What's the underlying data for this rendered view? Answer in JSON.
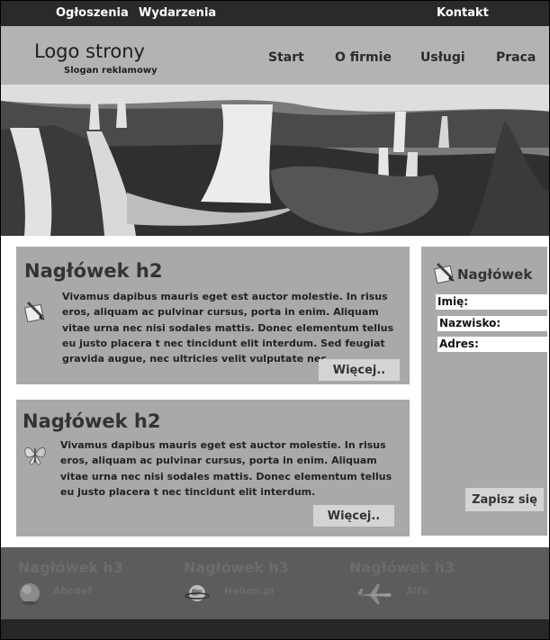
{
  "topnav": {
    "items": [
      "Ogłoszenia",
      "Wydarzenia"
    ],
    "contact": "Kontakt"
  },
  "header": {
    "logo": "Logo strony",
    "slogan": "Slogan reklamowy",
    "nav": [
      "Start",
      "O firmie",
      "Usługi",
      "Praca"
    ]
  },
  "articles": [
    {
      "heading": "Nagłówek h2",
      "text": "Vivamus dapibus mauris eget est auctor molestie. In risus eros, aliquam ac pulvinar cursus, porta in enim. Aliquam vitae urna nec nisi sodales mattis. Donec elementum tellus eu justo placera t nec tincidunt elit interdum. Sed feugiat gravida augue, nec ultricies velit vulputate nec",
      "more": "Więcej..",
      "icon": "pencil-notepad-icon"
    },
    {
      "heading": "Nagłówek h2",
      "text": "Vivamus dapibus mauris eget est auctor molestie. In risus eros, aliquam ac pulvinar cursus, porta in enim. Aliquam vitae urna nec nisi sodales mattis. Donec elementum tellus eu justo placera t nec tincidunt elit interdum.",
      "more": "Więcej..",
      "icon": "butterfly-icon"
    }
  ],
  "sidebar": {
    "heading": "Nagłówek",
    "fields": [
      "Imię:",
      "Nazwisko:",
      "Adres:"
    ],
    "submit": "Zapisz się",
    "icon": "pencil-notepad-icon"
  },
  "footer": {
    "columns": [
      {
        "heading": "Nagłówek h3",
        "text": "Abcdef",
        "icon": "globe-icon"
      },
      {
        "heading": "Nagłówek h3",
        "text": "Helion.pl",
        "icon": "planet-icon"
      },
      {
        "heading": "Nagłówek h3",
        "text": "Alfa",
        "icon": "jet-plane-icon"
      }
    ]
  },
  "hero": {
    "image": "waterfall-photo"
  },
  "colors": {
    "topbar": "#2a2a2a",
    "header": "#b3b3b3",
    "panel": "#a9a9a9",
    "button": "#d4d4d4",
    "footer": "#5c5c5c"
  }
}
